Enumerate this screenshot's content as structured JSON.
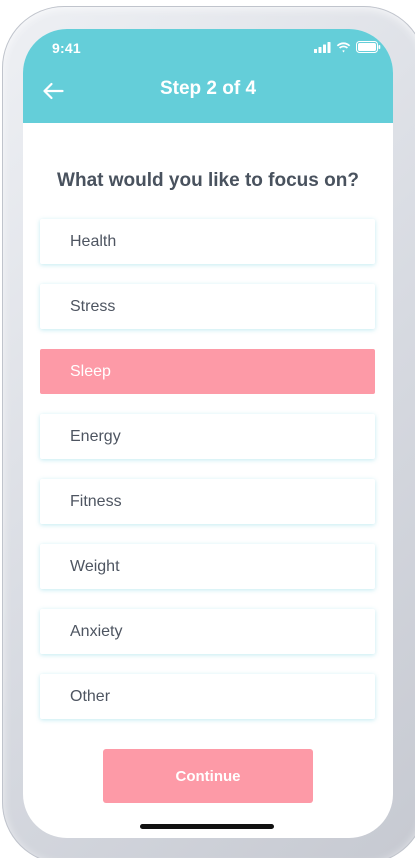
{
  "status_bar": {
    "time": "9:41",
    "icons": [
      "signal-icon",
      "wifi-icon",
      "battery-icon"
    ]
  },
  "header": {
    "back_icon": "arrow-left-icon",
    "title": "Step 2 of 4",
    "background_color": "#64ced9"
  },
  "question": "What would you like to focus on?",
  "options": [
    {
      "label": "Health",
      "selected": false
    },
    {
      "label": "Stress",
      "selected": false
    },
    {
      "label": "Sleep",
      "selected": true
    },
    {
      "label": "Energy",
      "selected": false
    },
    {
      "label": "Fitness",
      "selected": false
    },
    {
      "label": "Weight",
      "selected": false
    },
    {
      "label": "Anxiety",
      "selected": false
    },
    {
      "label": "Other",
      "selected": false
    }
  ],
  "continue_label": "Continue",
  "colors": {
    "accent": "#fd9aa7",
    "header": "#64ced9",
    "text": "#4e5561"
  }
}
